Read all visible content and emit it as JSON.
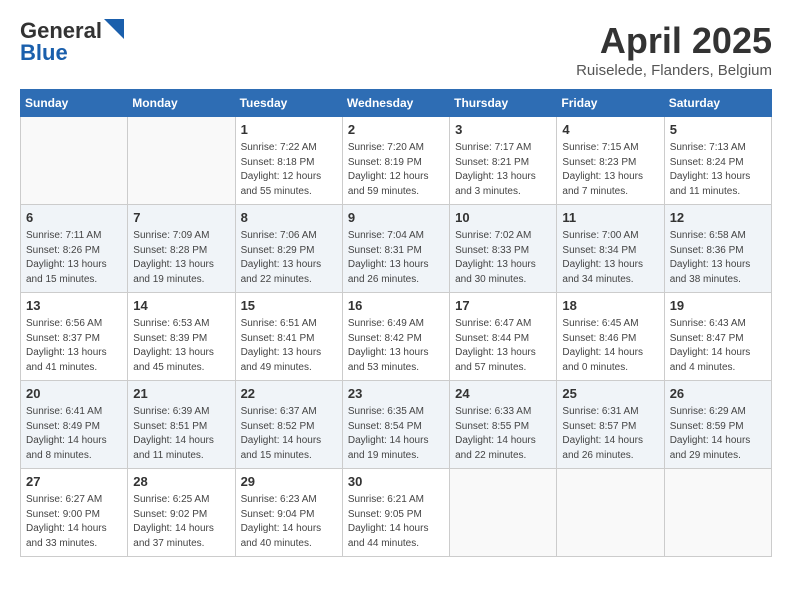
{
  "header": {
    "logo_general": "General",
    "logo_blue": "Blue",
    "month_title": "April 2025",
    "location": "Ruiselede, Flanders, Belgium"
  },
  "days_of_week": [
    "Sunday",
    "Monday",
    "Tuesday",
    "Wednesday",
    "Thursday",
    "Friday",
    "Saturday"
  ],
  "weeks": [
    [
      {
        "day": "",
        "info": ""
      },
      {
        "day": "",
        "info": ""
      },
      {
        "day": "1",
        "info": "Sunrise: 7:22 AM\nSunset: 8:18 PM\nDaylight: 12 hours\nand 55 minutes."
      },
      {
        "day": "2",
        "info": "Sunrise: 7:20 AM\nSunset: 8:19 PM\nDaylight: 12 hours\nand 59 minutes."
      },
      {
        "day": "3",
        "info": "Sunrise: 7:17 AM\nSunset: 8:21 PM\nDaylight: 13 hours\nand 3 minutes."
      },
      {
        "day": "4",
        "info": "Sunrise: 7:15 AM\nSunset: 8:23 PM\nDaylight: 13 hours\nand 7 minutes."
      },
      {
        "day": "5",
        "info": "Sunrise: 7:13 AM\nSunset: 8:24 PM\nDaylight: 13 hours\nand 11 minutes."
      }
    ],
    [
      {
        "day": "6",
        "info": "Sunrise: 7:11 AM\nSunset: 8:26 PM\nDaylight: 13 hours\nand 15 minutes."
      },
      {
        "day": "7",
        "info": "Sunrise: 7:09 AM\nSunset: 8:28 PM\nDaylight: 13 hours\nand 19 minutes."
      },
      {
        "day": "8",
        "info": "Sunrise: 7:06 AM\nSunset: 8:29 PM\nDaylight: 13 hours\nand 22 minutes."
      },
      {
        "day": "9",
        "info": "Sunrise: 7:04 AM\nSunset: 8:31 PM\nDaylight: 13 hours\nand 26 minutes."
      },
      {
        "day": "10",
        "info": "Sunrise: 7:02 AM\nSunset: 8:33 PM\nDaylight: 13 hours\nand 30 minutes."
      },
      {
        "day": "11",
        "info": "Sunrise: 7:00 AM\nSunset: 8:34 PM\nDaylight: 13 hours\nand 34 minutes."
      },
      {
        "day": "12",
        "info": "Sunrise: 6:58 AM\nSunset: 8:36 PM\nDaylight: 13 hours\nand 38 minutes."
      }
    ],
    [
      {
        "day": "13",
        "info": "Sunrise: 6:56 AM\nSunset: 8:37 PM\nDaylight: 13 hours\nand 41 minutes."
      },
      {
        "day": "14",
        "info": "Sunrise: 6:53 AM\nSunset: 8:39 PM\nDaylight: 13 hours\nand 45 minutes."
      },
      {
        "day": "15",
        "info": "Sunrise: 6:51 AM\nSunset: 8:41 PM\nDaylight: 13 hours\nand 49 minutes."
      },
      {
        "day": "16",
        "info": "Sunrise: 6:49 AM\nSunset: 8:42 PM\nDaylight: 13 hours\nand 53 minutes."
      },
      {
        "day": "17",
        "info": "Sunrise: 6:47 AM\nSunset: 8:44 PM\nDaylight: 13 hours\nand 57 minutes."
      },
      {
        "day": "18",
        "info": "Sunrise: 6:45 AM\nSunset: 8:46 PM\nDaylight: 14 hours\nand 0 minutes."
      },
      {
        "day": "19",
        "info": "Sunrise: 6:43 AM\nSunset: 8:47 PM\nDaylight: 14 hours\nand 4 minutes."
      }
    ],
    [
      {
        "day": "20",
        "info": "Sunrise: 6:41 AM\nSunset: 8:49 PM\nDaylight: 14 hours\nand 8 minutes."
      },
      {
        "day": "21",
        "info": "Sunrise: 6:39 AM\nSunset: 8:51 PM\nDaylight: 14 hours\nand 11 minutes."
      },
      {
        "day": "22",
        "info": "Sunrise: 6:37 AM\nSunset: 8:52 PM\nDaylight: 14 hours\nand 15 minutes."
      },
      {
        "day": "23",
        "info": "Sunrise: 6:35 AM\nSunset: 8:54 PM\nDaylight: 14 hours\nand 19 minutes."
      },
      {
        "day": "24",
        "info": "Sunrise: 6:33 AM\nSunset: 8:55 PM\nDaylight: 14 hours\nand 22 minutes."
      },
      {
        "day": "25",
        "info": "Sunrise: 6:31 AM\nSunset: 8:57 PM\nDaylight: 14 hours\nand 26 minutes."
      },
      {
        "day": "26",
        "info": "Sunrise: 6:29 AM\nSunset: 8:59 PM\nDaylight: 14 hours\nand 29 minutes."
      }
    ],
    [
      {
        "day": "27",
        "info": "Sunrise: 6:27 AM\nSunset: 9:00 PM\nDaylight: 14 hours\nand 33 minutes."
      },
      {
        "day": "28",
        "info": "Sunrise: 6:25 AM\nSunset: 9:02 PM\nDaylight: 14 hours\nand 37 minutes."
      },
      {
        "day": "29",
        "info": "Sunrise: 6:23 AM\nSunset: 9:04 PM\nDaylight: 14 hours\nand 40 minutes."
      },
      {
        "day": "30",
        "info": "Sunrise: 6:21 AM\nSunset: 9:05 PM\nDaylight: 14 hours\nand 44 minutes."
      },
      {
        "day": "",
        "info": ""
      },
      {
        "day": "",
        "info": ""
      },
      {
        "day": "",
        "info": ""
      }
    ]
  ]
}
